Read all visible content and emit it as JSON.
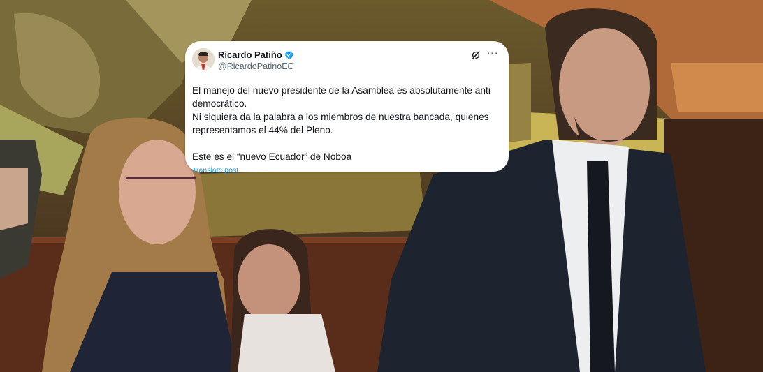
{
  "tweet": {
    "display_name": "Ricardo Patiño",
    "handle": "@RicardoPatinoEC",
    "verified": true,
    "lines": [
      "El manejo del nuevo presidente de la Asamblea es absolutamente anti democrático.",
      "Ni siquiera da la palabra a los miembros de nuestra bancada, quienes representamos el 44% del Pleno.",
      "",
      "Este es el “nuevo Ecuador” de Noboa"
    ],
    "translate_label": "Translate post",
    "more_label": "···",
    "icons": {
      "verified": "verified-badge-icon",
      "grok": "grok-icon",
      "more": "more-options-icon"
    }
  },
  "colors": {
    "card_bg": "#ffffff",
    "text": "#0f1419",
    "secondary": "#536471",
    "link": "#1d9bf0",
    "verified": "#1d9bf0"
  }
}
